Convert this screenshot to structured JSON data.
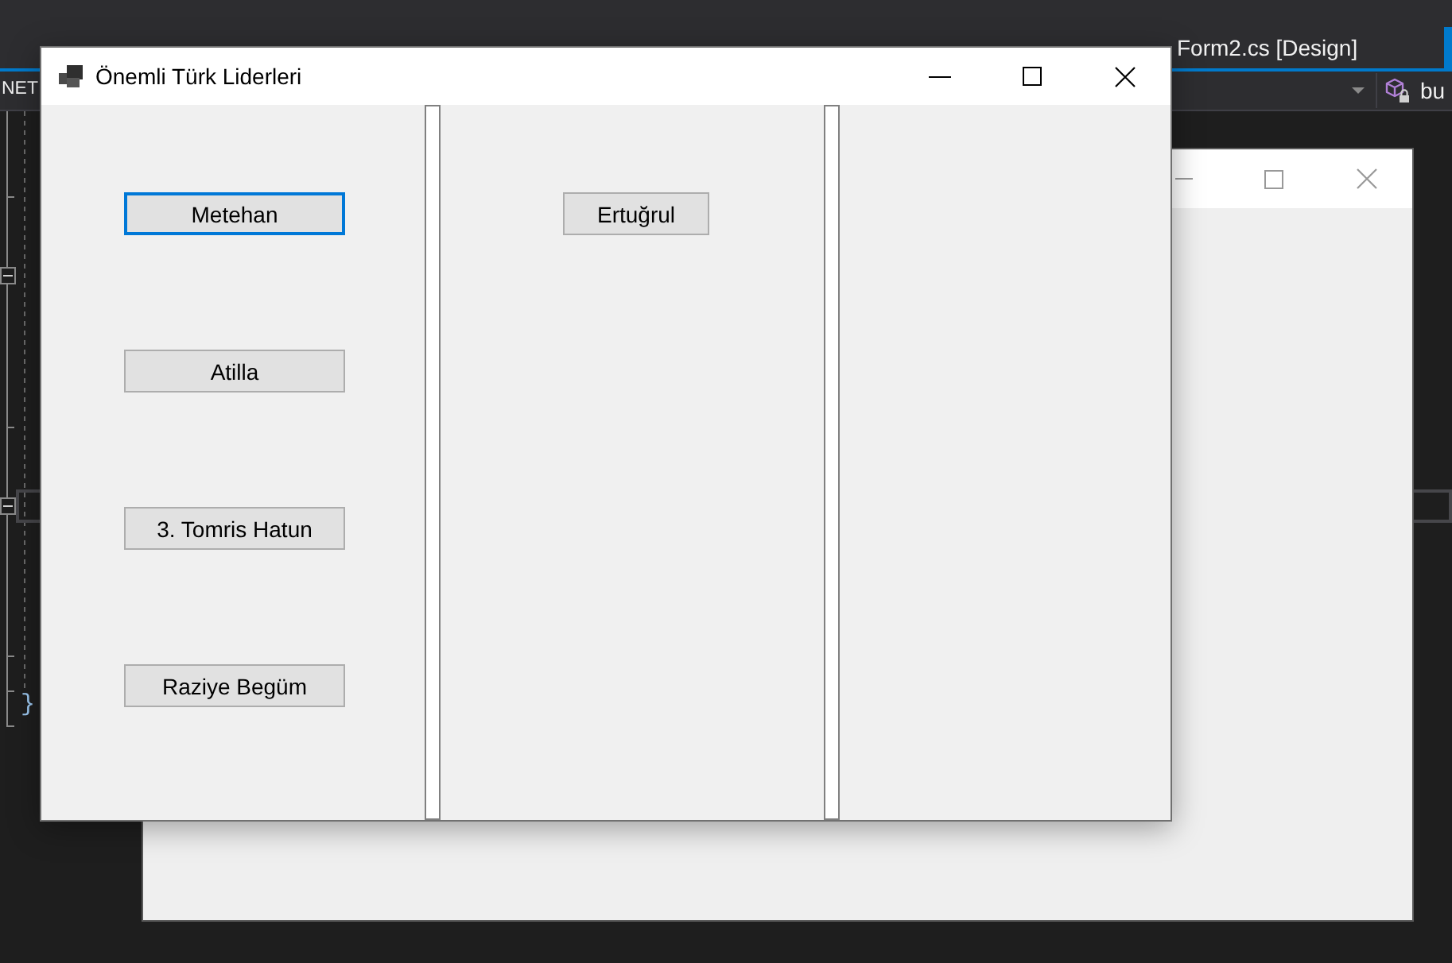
{
  "ide": {
    "tabs": [
      {
        "label": "Form2.cs [Design]",
        "selected": false
      }
    ],
    "navigation_bar": {
      "project": "NET",
      "member": "bu"
    },
    "editor": {
      "text": "}"
    }
  },
  "window": {
    "title": "Önemli Türk Liderleri"
  },
  "panels": [
    {
      "buttons": [
        {
          "label": "Metehan",
          "focused": true
        },
        {
          "label": "Atilla",
          "focused": false
        },
        {
          "label": "3. Tomris Hatun",
          "focused": false
        },
        {
          "label": "Raziye Begüm",
          "focused": false
        }
      ]
    },
    {
      "buttons": [
        {
          "label": "Ertuğrul",
          "focused": false
        }
      ]
    }
  ]
}
